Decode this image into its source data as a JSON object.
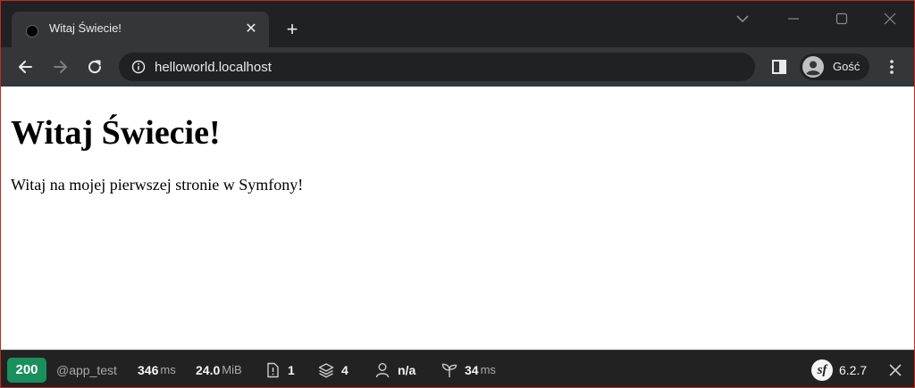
{
  "browser": {
    "tab": {
      "title": "Witaj Świecie!",
      "close_glyph": "✕"
    },
    "new_tab_glyph": "+",
    "address_bar": {
      "url": "helloworld.localhost"
    },
    "profile": {
      "name": "Gość"
    }
  },
  "page": {
    "heading": "Witaj Świecie!",
    "paragraph": "Witaj na mojej pierwszej stronie w Symfony!"
  },
  "symfony_toolbar": {
    "status_code": "200",
    "route": "@app_test",
    "time": {
      "value": "346",
      "unit": "ms"
    },
    "memory": {
      "value": "24.0",
      "unit": "MiB"
    },
    "logs": "1",
    "twig": "4",
    "user": "n/a",
    "doctrine": {
      "value": "34",
      "unit": "ms"
    },
    "version": "6.2.7",
    "logo_glyph": "sf",
    "colors": {
      "status_ok": "#1a8f5e",
      "bar": "#222222"
    }
  },
  "icons": {
    "favicon": "favicon-icon",
    "back": "arrow-left-icon",
    "forward": "arrow-right-icon",
    "reload": "reload-icon",
    "info": "info-icon",
    "side_panel": "side-panel-icon",
    "avatar": "avatar-icon",
    "menu": "kebab-menu-icon"
  }
}
